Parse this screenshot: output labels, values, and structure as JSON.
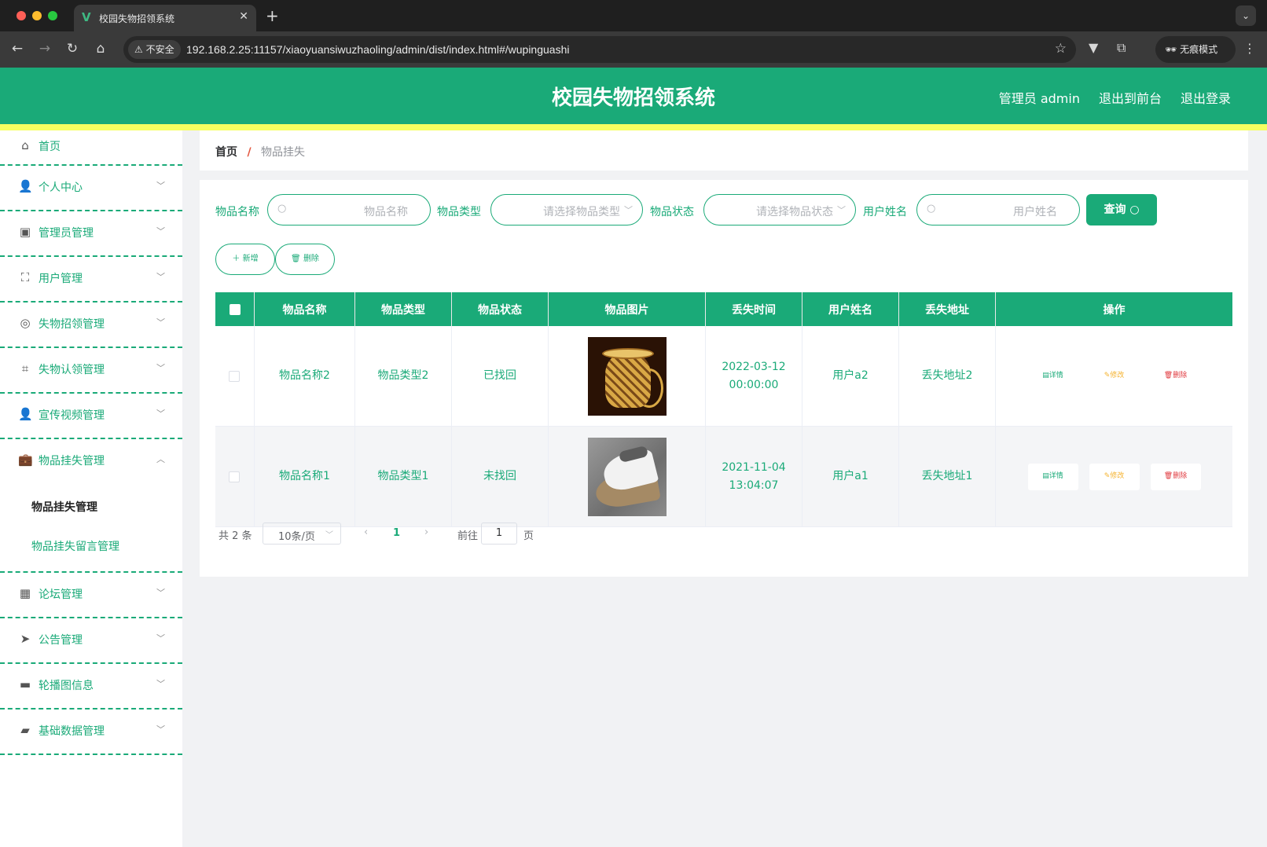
{
  "browser": {
    "tab_title": "校园失物招领系统",
    "tab_favicon": "V",
    "insecure_label": "不安全",
    "url": "192.168.2.25:11157/xiaoyuansiwuzhaoling/admin/dist/index.html#/wupinguashi",
    "incognito_label": "无痕模式"
  },
  "header": {
    "title": "校园失物招领系统",
    "user_label": "管理员 admin",
    "front_label": "退出到前台",
    "logout_label": "退出登录"
  },
  "sidebar": {
    "items": [
      {
        "label": "首页",
        "icon": "home-icon"
      },
      {
        "label": "个人中心",
        "icon": "user-icon"
      },
      {
        "label": "管理员管理",
        "icon": "clipboard-icon"
      },
      {
        "label": "用户管理",
        "icon": "fullscreen-icon"
      },
      {
        "label": "失物招领管理",
        "icon": "compass-icon"
      },
      {
        "label": "失物认领管理",
        "icon": "crop-icon"
      },
      {
        "label": "宣传视频管理",
        "icon": "user-icon"
      },
      {
        "label": "物品挂失管理",
        "icon": "briefcase-icon"
      },
      {
        "label": "论坛管理",
        "icon": "grid-icon"
      },
      {
        "label": "公告管理",
        "icon": "send-icon"
      },
      {
        "label": "轮播图信息",
        "icon": "brush-icon"
      },
      {
        "label": "基础数据管理",
        "icon": "ticket-icon"
      }
    ],
    "submenu": [
      {
        "label": "物品挂失管理",
        "active": true
      },
      {
        "label": "物品挂失留言管理",
        "active": false
      }
    ]
  },
  "breadcrumb": {
    "home": "首页",
    "separator": "/",
    "current": "物品挂失"
  },
  "search": {
    "name_label": "物品名称",
    "name_placeholder": "物品名称",
    "type_label": "物品类型",
    "type_placeholder": "请选择物品类型",
    "state_label": "物品状态",
    "state_placeholder": "请选择物品状态",
    "user_label": "用户姓名",
    "user_placeholder": "用户姓名",
    "query_label": "查询"
  },
  "actions": {
    "add_label": "新增",
    "delete_label": "删除"
  },
  "table": {
    "columns": [
      "物品名称",
      "物品类型",
      "物品状态",
      "物品图片",
      "丢失时间",
      "用户姓名",
      "丢失地址",
      "操作"
    ],
    "rows": [
      {
        "name": "物品名称2",
        "type": "物品类型2",
        "state": "已找回",
        "image": "woven-basket-photo",
        "time": "2022-03-12 00:00:00",
        "user": "用户a2",
        "addr": "丢失地址2"
      },
      {
        "name": "物品名称1",
        "type": "物品类型1",
        "state": "未找回",
        "image": "clothes-iron-photo",
        "time": "2021-11-04 13:04:07",
        "user": "用户a1",
        "addr": "丢失地址1"
      }
    ],
    "ops": {
      "detail": "详情",
      "edit": "修改",
      "delete": "删除"
    }
  },
  "pagination": {
    "total": "共 2 条",
    "page_size": "10条/页",
    "current": "1",
    "goto_label": "前往",
    "goto_value": "1",
    "page_suffix": "页"
  },
  "colors": {
    "primary": "#1aaa78",
    "stripe": "#f6ff60",
    "edit": "#f5b22e",
    "danger": "#e0393e"
  }
}
